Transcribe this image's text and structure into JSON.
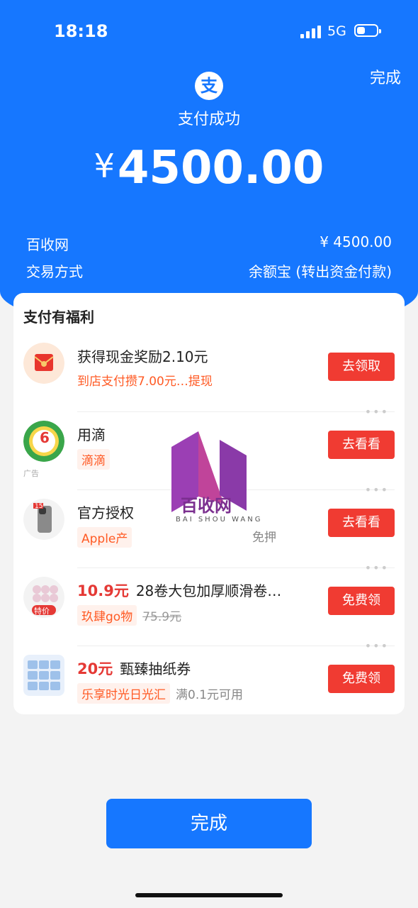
{
  "status_bar": {
    "time": "18:18",
    "network": "5G"
  },
  "header": {
    "done_label": "完成",
    "logo_glyph": "支",
    "success_text": "支付成功",
    "currency_symbol": "¥",
    "amount": "4500.00"
  },
  "details": [
    {
      "label": "百收网",
      "value": "¥ 4500.00"
    },
    {
      "label": "交易方式",
      "value": "余额宝 (转出资金付款)"
    }
  ],
  "benefits": {
    "title": "支付有福利",
    "items": [
      {
        "title": "获得现金奖励2.10元",
        "sub": "到店支付攒7.00元…提现",
        "button": "去领取",
        "icon": "red-envelope-icon"
      },
      {
        "title": "用滴",
        "tag": "滴滴",
        "button": "去看看",
        "icon": "coupon-badge-icon",
        "badge": "6",
        "ad_label": "广告"
      },
      {
        "title": "官方授权",
        "tag": "Apple产",
        "extra": "免押",
        "button": "去看看",
        "icon": "iphone-icon",
        "phone_badge": "15"
      },
      {
        "price": "10.9元",
        "title": "28卷大包加厚顺滑卷…",
        "tag": "玖肆go物",
        "original_price": "75.9元",
        "button": "免费领",
        "icon": "tissue-roll-icon",
        "badge": "特价"
      },
      {
        "price": "20元",
        "title": "甄臻抽纸券",
        "tag": "乐享时光日光汇",
        "extra": "满0.1元可用",
        "button": "免费领",
        "icon": "tissue-box-icon"
      }
    ]
  },
  "watermark": {
    "text": "百收网",
    "sub": "BAI SHOU WANG"
  },
  "footer": {
    "done_label": "完成"
  },
  "colors": {
    "brand_blue": "#1677ff",
    "action_red": "#f03b32",
    "tag_orange": "#ff5a24"
  }
}
